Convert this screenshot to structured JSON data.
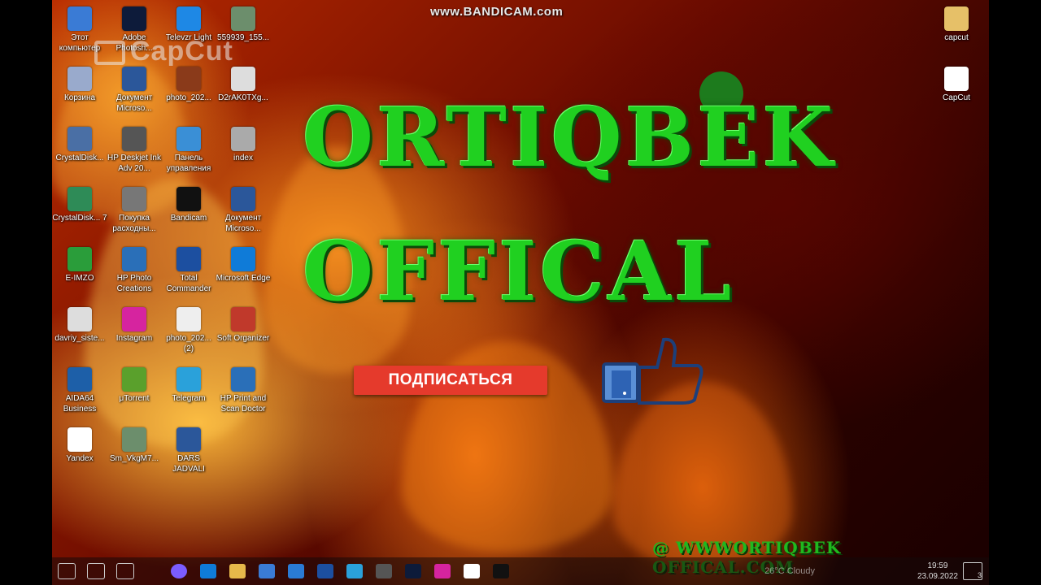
{
  "watermark_top": "www.BANDICAM.com",
  "capcut_watermark": "CapCut",
  "title_line1": "ORTIQBEK",
  "title_line2": "OFFICAL",
  "subscribe_label": "ПОДПИСАТЬСЯ",
  "site_watermark": "@ WWWORTIQBEK OFFICAL.COM",
  "desktop_icons": [
    {
      "label": "Этот компьютер",
      "icon": "computer-icon"
    },
    {
      "label": "Adobe Photosh...",
      "icon": "photoshop-icon"
    },
    {
      "label": "Televzr Light",
      "icon": "televzr-icon"
    },
    {
      "label": "559939_155...",
      "icon": "image-file-icon"
    },
    {
      "label": "Корзина",
      "icon": "recycle-bin-icon"
    },
    {
      "label": "Документ Microso...",
      "icon": "word-doc-icon"
    },
    {
      "label": "photo_202...",
      "icon": "photo-icon"
    },
    {
      "label": "D2rAK0TXg...",
      "icon": "file-icon"
    },
    {
      "label": "CrystalDisk...",
      "icon": "crystaldisk-icon"
    },
    {
      "label": "HP Deskjet Ink Adv 20...",
      "icon": "printer-icon"
    },
    {
      "label": "Панель управления",
      "icon": "control-panel-icon"
    },
    {
      "label": "index",
      "icon": "index-file-icon"
    },
    {
      "label": "CrystalDisk... 7",
      "icon": "crystaldisk-mark-icon"
    },
    {
      "label": "Покупка расходны...",
      "icon": "shop-icon"
    },
    {
      "label": "Bandicam",
      "icon": "bandicam-icon"
    },
    {
      "label": "Документ Microso...",
      "icon": "word-doc-icon"
    },
    {
      "label": "E-IMZO",
      "icon": "eimzo-icon"
    },
    {
      "label": "HP Photo Creations",
      "icon": "hp-photo-icon"
    },
    {
      "label": "Total Commander",
      "icon": "total-commander-icon"
    },
    {
      "label": "Microsoft Edge",
      "icon": "edge-icon"
    },
    {
      "label": "davriy_siste...",
      "icon": "file-icon"
    },
    {
      "label": "Instagram",
      "icon": "instagram-icon"
    },
    {
      "label": "photo_202... (2)",
      "icon": "pdf-icon"
    },
    {
      "label": "Soft Organizer",
      "icon": "soft-organizer-icon"
    },
    {
      "label": "AIDA64 Business",
      "icon": "aida64-icon"
    },
    {
      "label": "μTorrent",
      "icon": "utorrent-icon"
    },
    {
      "label": "Telegram",
      "icon": "telegram-icon"
    },
    {
      "label": "HP Print and Scan Doctor",
      "icon": "hp-print-icon"
    },
    {
      "label": "Yandex",
      "icon": "yandex-icon"
    },
    {
      "label": "Sm_VkgM7...",
      "icon": "image-file-icon"
    },
    {
      "label": "DARS JADVALI",
      "icon": "word-doc-icon"
    }
  ],
  "right_icons": [
    {
      "label": "capcut",
      "icon": "folder-icon"
    },
    {
      "label": "CapCut",
      "icon": "capcut-icon"
    }
  ],
  "taskbar_apps": [
    "start-icon",
    "search-icon",
    "task-view-icon",
    "cortana-icon",
    "edge-icon",
    "explorer-icon",
    "store-icon",
    "mail-icon",
    "save-icon",
    "telegram-icon",
    "calculator-icon",
    "photoshop-icon",
    "instagram-icon",
    "yandex-icon",
    "bandicam-icon"
  ],
  "tray": {
    "weather": "26°C Cloudy",
    "time": "19:59",
    "date": "23.09.2022",
    "notifications": "3"
  }
}
